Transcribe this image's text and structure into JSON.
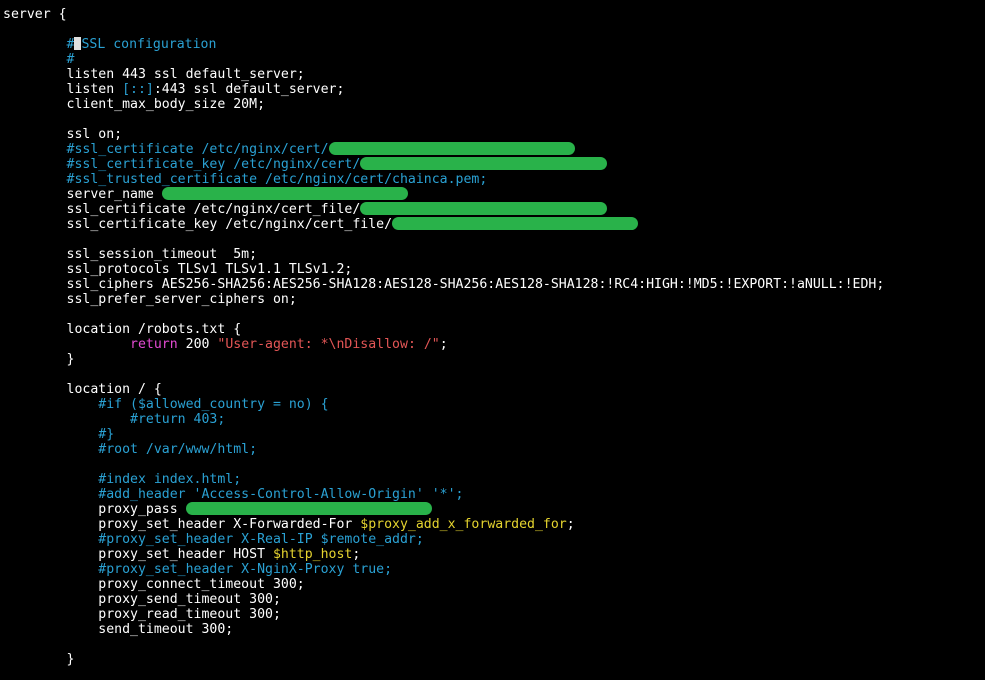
{
  "colors": {
    "background": "#000000",
    "plain": "#ffffff",
    "comment": "#2aa1d3",
    "keyword": "#e34bd2",
    "string": "#e35656",
    "variable": "#e5d42f",
    "redaction": "#29b24a",
    "cursor": "#e0e0e0"
  },
  "editor": {
    "lines": [
      [
        {
          "t": "server {",
          "c": "plain"
        }
      ],
      [],
      [
        {
          "t": "        #",
          "c": "comment"
        },
        {
          "cursor": true
        },
        {
          "t": "SSL configuration",
          "c": "comment"
        }
      ],
      [
        {
          "t": "        #",
          "c": "comment"
        }
      ],
      [
        {
          "t": "        listen 443 ssl default_server;",
          "c": "plain"
        }
      ],
      [
        {
          "t": "        listen ",
          "c": "plain"
        },
        {
          "t": "[::]",
          "c": "bracket"
        },
        {
          "t": ":443 ssl default_server;",
          "c": "plain"
        }
      ],
      [
        {
          "t": "        client_max_body_size 20M;",
          "c": "plain"
        }
      ],
      [],
      [
        {
          "t": "        ssl on;",
          "c": "plain"
        }
      ],
      [
        {
          "t": "        #ssl_certificate /etc/nginx/cert/",
          "c": "comment"
        },
        {
          "redact": 31
        }
      ],
      [
        {
          "t": "        #ssl_certificate_key /etc/nginx/cert/",
          "c": "comment"
        },
        {
          "redact": 31
        }
      ],
      [
        {
          "t": "        #ssl_trusted_certificate /etc/nginx/cert/chainca.pem;",
          "c": "comment"
        }
      ],
      [
        {
          "t": "        server_name ",
          "c": "plain"
        },
        {
          "redact": 31
        }
      ],
      [
        {
          "t": "        ssl_certificate /etc/nginx/cert_file/",
          "c": "plain"
        },
        {
          "redact": 31
        }
      ],
      [
        {
          "t": "        ssl_certificate_key /etc/nginx/cert_file/",
          "c": "plain"
        },
        {
          "redact": 31
        }
      ],
      [],
      [
        {
          "t": "        ssl_session_timeout  5m;",
          "c": "plain"
        }
      ],
      [
        {
          "t": "        ssl_protocols TLSv1 TLSv1.1 TLSv1.2;",
          "c": "plain"
        }
      ],
      [
        {
          "t": "        ssl_ciphers AES256-SHA256:AES256-SHA128:AES128-SHA256:AES128-SHA128:!RC4:HIGH:!MD5:!EXPORT:!aNULL:!EDH;",
          "c": "plain"
        }
      ],
      [
        {
          "t": "        ssl_prefer_server_ciphers on;",
          "c": "plain"
        }
      ],
      [],
      [
        {
          "t": "        location /robots.txt {",
          "c": "plain"
        }
      ],
      [
        {
          "t": "                ",
          "c": "plain"
        },
        {
          "t": "return",
          "c": "keyword"
        },
        {
          "t": " 200 ",
          "c": "plain"
        },
        {
          "t": "\"User-agent: *\\nDisallow: /\"",
          "c": "string"
        },
        {
          "t": ";",
          "c": "plain"
        }
      ],
      [
        {
          "t": "        }",
          "c": "plain"
        }
      ],
      [],
      [
        {
          "t": "        location / {",
          "c": "plain"
        }
      ],
      [
        {
          "t": "            #if ($allowed_country = no) {",
          "c": "comment"
        }
      ],
      [
        {
          "t": "                #return 403;",
          "c": "comment"
        }
      ],
      [
        {
          "t": "            #}",
          "c": "comment"
        }
      ],
      [
        {
          "t": "            #root /var/www/html;",
          "c": "comment"
        }
      ],
      [],
      [
        {
          "t": "            #index index.html;",
          "c": "comment"
        }
      ],
      [
        {
          "t": "            #add_header 'Access-Control-Allow-Origin' '*';",
          "c": "comment"
        }
      ],
      [
        {
          "t": "            proxy_pass ",
          "c": "plain"
        },
        {
          "redact": 31
        }
      ],
      [
        {
          "t": "            proxy_set_header X-Forwarded-For ",
          "c": "plain"
        },
        {
          "t": "$proxy_add_x_forwarded_for",
          "c": "var"
        },
        {
          "t": ";",
          "c": "plain"
        }
      ],
      [
        {
          "t": "            #proxy_set_header X-Real-IP $remote_addr;",
          "c": "comment"
        }
      ],
      [
        {
          "t": "            proxy_set_header HOST ",
          "c": "plain"
        },
        {
          "t": "$http_host",
          "c": "var"
        },
        {
          "t": ";",
          "c": "plain"
        }
      ],
      [
        {
          "t": "            #proxy_set_header X-NginX-Proxy true;",
          "c": "comment"
        }
      ],
      [
        {
          "t": "            proxy_connect_timeout 300;",
          "c": "plain"
        }
      ],
      [
        {
          "t": "            proxy_send_timeout 300;",
          "c": "plain"
        }
      ],
      [
        {
          "t": "            proxy_read_timeout 300;",
          "c": "plain"
        }
      ],
      [
        {
          "t": "            send_timeout 300;",
          "c": "plain"
        }
      ],
      [],
      [
        {
          "t": "        }",
          "c": "plain"
        }
      ]
    ]
  }
}
